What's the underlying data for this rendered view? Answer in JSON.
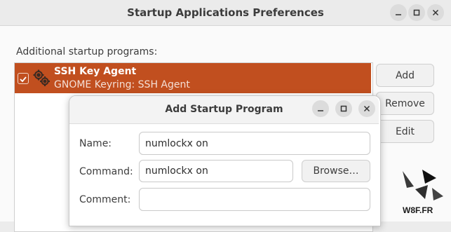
{
  "window": {
    "title": "Startup Applications Preferences",
    "controls": {
      "minimize": "minimize-icon",
      "maximize": "maximize-icon",
      "close": "close-icon"
    }
  },
  "main": {
    "section_label": "Additional startup programs:",
    "programs": [
      {
        "enabled": true,
        "name": "SSH Key Agent",
        "description": "GNOME Keyring: SSH Agent",
        "selected": true
      }
    ],
    "buttons": {
      "add": "Add",
      "remove": "Remove",
      "edit": "Edit"
    }
  },
  "dialog": {
    "title": "Add Startup Program",
    "name_label": "Name:",
    "name_value": "numlockx on",
    "command_label": "Command:",
    "command_value": "numlockx on",
    "browse_label": "Browse…",
    "comment_label": "Comment:",
    "comment_value": ""
  },
  "watermark": {
    "text": "W8F.FR"
  },
  "colors": {
    "selection": "#c14f1f",
    "background": "#fafafa"
  }
}
